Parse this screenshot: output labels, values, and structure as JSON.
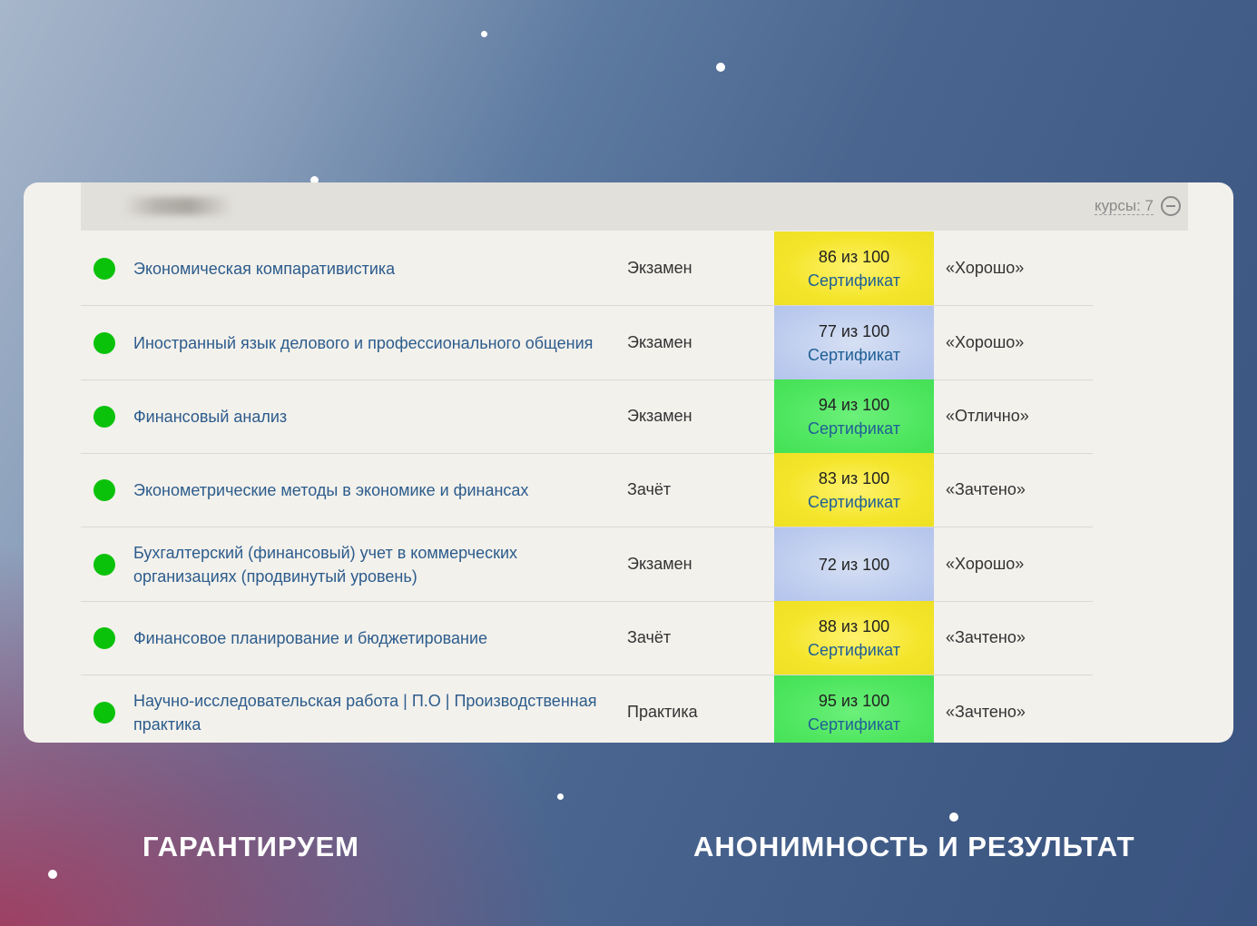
{
  "group": {
    "courses_label": "курсы: 7"
  },
  "rows": [
    {
      "name": "Экономическая компаративистика",
      "type": "Экзамен",
      "score": "86 из 100",
      "certificate": "Сертификат",
      "grade": "«Хорошо»",
      "color": "#f4e52a"
    },
    {
      "name": "Иностранный язык делового и профессионального общения",
      "type": "Экзамен",
      "score": "77 из 100",
      "certificate": "Сертификат",
      "grade": "«Хорошо»",
      "color": "#bccbee"
    },
    {
      "name": "Финансовый анализ",
      "type": "Экзамен",
      "score": "94 из 100",
      "certificate": "Сертификат",
      "grade": "«Отлично»",
      "color": "#4fe660"
    },
    {
      "name": "Эконометрические методы в экономике и финансах",
      "type": "Зачёт",
      "score": "83 из 100",
      "certificate": "Сертификат",
      "grade": "«Зачтено»",
      "color": "#f4e52a"
    },
    {
      "name_line1": "Бухгалтерский (финансовый) учет в коммерческих",
      "name_line2": "организациях (продвинутый уровень)",
      "type": "Экзамен",
      "score": "72 из 100",
      "grade": "«Хорошо»",
      "color": "#bccbee"
    },
    {
      "name": "Финансовое планирование и бюджетирование",
      "type": "Зачёт",
      "score": "88 из 100",
      "certificate": "Сертификат",
      "grade": "«Зачтено»",
      "color": "#f4e52a"
    },
    {
      "name_line1": "Научно-исследовательская работа | П.О | Производственная",
      "name_line2": "практика",
      "type": "Практика",
      "score": "95 из 100",
      "certificate": "Сертификат",
      "grade": "«Зачтено»",
      "color": "#4fe660"
    }
  ],
  "captions": {
    "left": "ГАРАНТИРУЕМ",
    "right": "АНОНИМНОСТЬ И РЕЗУЛЬТАТ"
  },
  "colors": {
    "status_ok": "#0bc20b",
    "link": "#2c5c8c"
  }
}
